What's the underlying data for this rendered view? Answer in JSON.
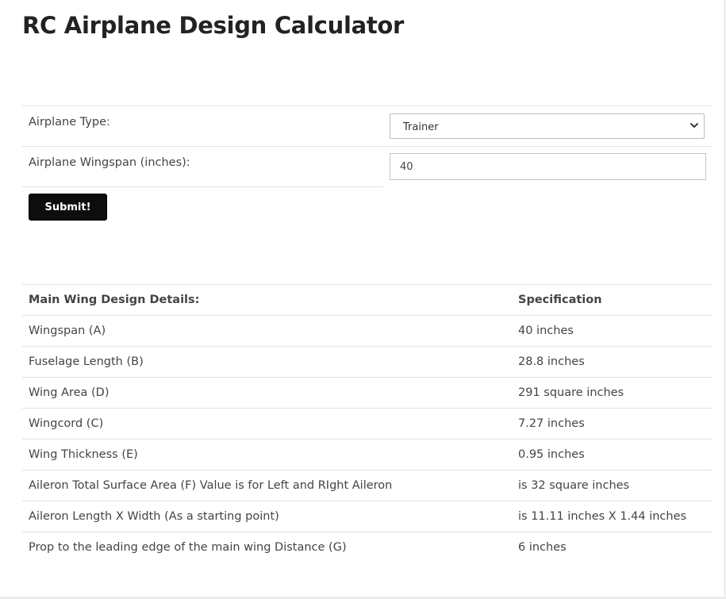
{
  "page": {
    "title": "RC Airplane Design Calculator"
  },
  "form": {
    "airplane_type_label": "Airplane Type:",
    "airplane_type_value": "Trainer",
    "wingspan_label": "Airplane Wingspan (inches):",
    "wingspan_value": "40",
    "submit_label": "Submit!"
  },
  "results": {
    "header": {
      "detail": "Main Wing Design Details:",
      "spec": "Specification"
    },
    "rows": [
      {
        "detail": "Wingspan (A)",
        "spec": "40 inches"
      },
      {
        "detail": "Fuselage Length (B)",
        "spec": "28.8 inches"
      },
      {
        "detail": "Wing Area (D)",
        "spec": "291 square inches"
      },
      {
        "detail": "Wingcord (C)",
        "spec": "7.27 inches"
      },
      {
        "detail": "Wing Thickness (E)",
        "spec": "0.95 inches"
      },
      {
        "detail": "Aileron Total Surface Area (F) Value is for Left and RIght Aileron",
        "spec": "is 32 square inches"
      },
      {
        "detail": "Aileron Length X Width (As a starting point)",
        "spec": "is 11.11 inches X 1.44 inches"
      },
      {
        "detail": "Prop to the leading edge of the main wing Distance (G)",
        "spec": "6 inches"
      }
    ]
  },
  "icons": {
    "select_arrow": "chevron-down-icon"
  }
}
